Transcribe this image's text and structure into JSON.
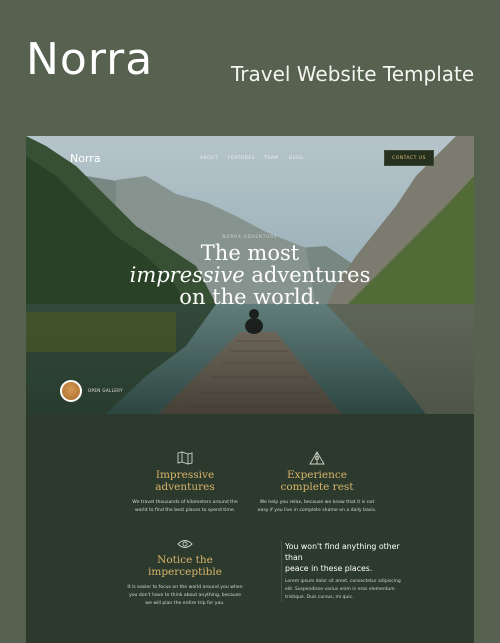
{
  "header": {
    "brand": "Norra",
    "tagline": "Travel Website Template"
  },
  "preview": {
    "nav": {
      "logo": "Norra",
      "links": [
        "ABOUT",
        "FEATURES",
        "TEAM",
        "BLOG"
      ],
      "cta": "CONTACT US"
    },
    "hero": {
      "eyebrow": "NORRA ADVENTURE",
      "title_line1": "The most",
      "title_line2_italic": "impressive",
      "title_line2_rest": " adventures",
      "title_line3": "on the world.",
      "gallery_label": "OPEN GALLERY"
    },
    "features": [
      {
        "icon": "map-icon",
        "title_line1": "Impressive",
        "title_line2": "adventures",
        "desc_line1": "We travel thousands of kilometers around the",
        "desc_line2": "world to find the best places to spend time."
      },
      {
        "icon": "tent-icon",
        "title_line1": "Experience",
        "title_line2": "complete rest",
        "desc_line1": "We help you relax, because we know that it is not",
        "desc_line2": "easy if you live in complete shame on a daily basis."
      },
      {
        "icon": "eye-icon",
        "title_line1": "Notice the",
        "title_line2": "imperceptible",
        "desc_line1": "It is easier to focus on the world around you when",
        "desc_line2": "you don't have to think about anything, because",
        "desc_line3": "we will plan the entire trip for you."
      }
    ],
    "promo": {
      "title_line1": "You won't find anything other than",
      "title_line2": "peace in these places.",
      "desc_line1": "Lorem ipsum dolor sit amet, consectetur adipiscing",
      "desc_line2": "elit. Suspendisse varius enim in eros elementum",
      "desc_line3": "tristique. Duis cursus, mi quis."
    }
  },
  "colors": {
    "background": "#56624f",
    "panel": "#2c3a2d",
    "accent_gold": "#d9b36a"
  }
}
